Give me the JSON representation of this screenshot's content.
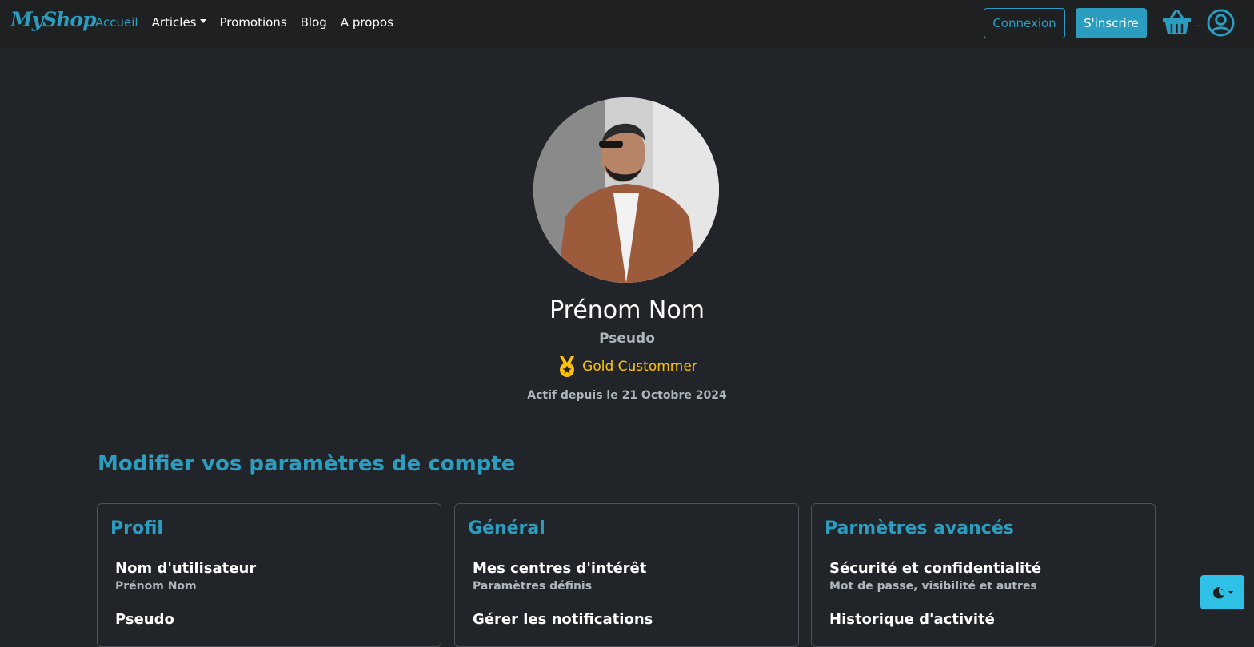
{
  "brand": "MyShop",
  "nav": {
    "items": [
      {
        "label": "Accueil",
        "active": true
      },
      {
        "label": "Articles",
        "dropdown": true
      },
      {
        "label": "Promotions"
      },
      {
        "label": "Blog"
      },
      {
        "label": "A propos"
      }
    ],
    "login_label": "Connexion",
    "signup_label": "S'inscrire",
    "cart_icon": "basket-icon",
    "cart_count": "-",
    "account_icon": "user-circle-icon"
  },
  "profile": {
    "full_name": "Prénom Nom",
    "pseudo": "Pseudo",
    "badge_label": "Gold Custommer",
    "badge_icon": "medal-icon",
    "active_since": "Actif depuis le 21 Octobre 2024"
  },
  "settings": {
    "title": "Modifier vos paramètres de compte",
    "cards": [
      {
        "title": "Profil",
        "items": [
          {
            "title": "Nom d'utilisateur",
            "subtitle": "Prénom Nom"
          },
          {
            "title": "Pseudo",
            "subtitle": ""
          }
        ]
      },
      {
        "title": "Général",
        "items": [
          {
            "title": "Mes centres d'intérêt",
            "subtitle": "Paramètres définis"
          },
          {
            "title": "Gérer les notifications",
            "subtitle": ""
          }
        ]
      },
      {
        "title": "Parmètres avancés",
        "items": [
          {
            "title": "Sécurité et confidentialité",
            "subtitle": "Mot de passe, visibilité et autres"
          },
          {
            "title": "Historique d'activité",
            "subtitle": ""
          }
        ]
      }
    ]
  },
  "theme_toggle_icon": "moon-stars-icon",
  "colors": {
    "accent": "#2a9dc0",
    "background": "#212529",
    "navbar": "#1f2022",
    "gold": "#ffc107",
    "theme_button": "#2fc0e6"
  }
}
